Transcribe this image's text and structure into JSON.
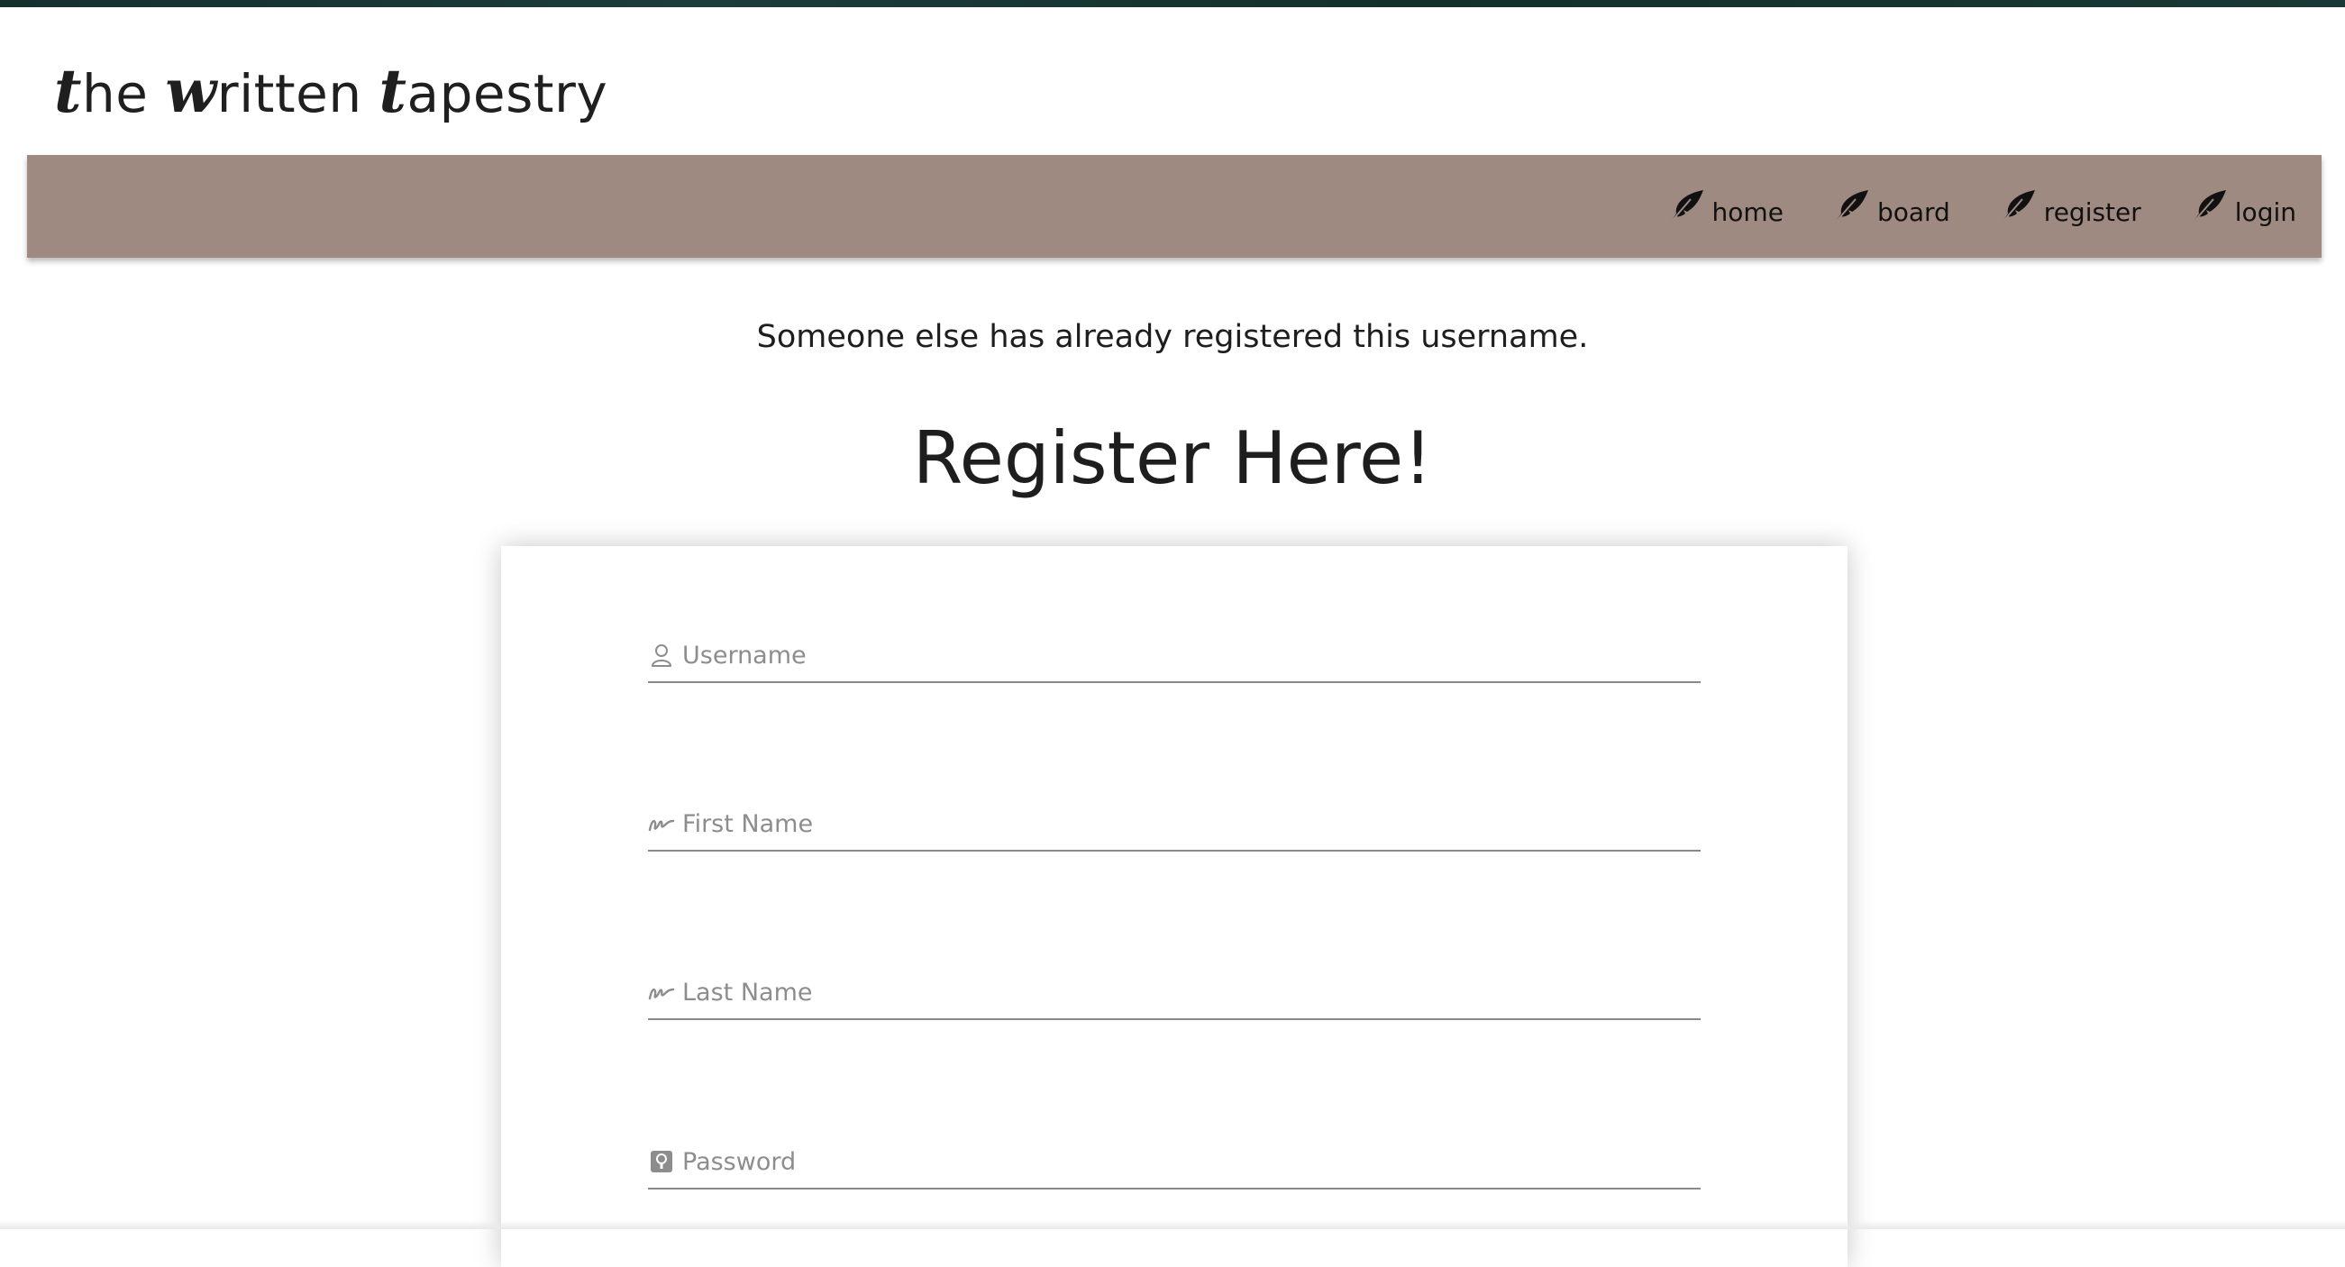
{
  "brand": {
    "cap1": "t",
    "rest1": "he ",
    "cap2": "w",
    "rest2": "ritten ",
    "cap3": "t",
    "rest3": "apestry"
  },
  "nav": {
    "items": [
      {
        "label": "home",
        "icon": "feather-icon"
      },
      {
        "label": "board",
        "icon": "feather-icon"
      },
      {
        "label": "register",
        "icon": "feather-icon"
      },
      {
        "label": "login",
        "icon": "feather-icon"
      }
    ],
    "background_color": "#9e8a80"
  },
  "message": "Someone else has already registered this username.",
  "title": "Register Here!",
  "form": {
    "username": {
      "placeholder": "Username",
      "value": "",
      "icon": "user-icon"
    },
    "first_name": {
      "placeholder": "First Name",
      "value": "",
      "icon": "signature-icon"
    },
    "last_name": {
      "placeholder": "Last Name",
      "value": "",
      "icon": "signature-icon"
    },
    "password": {
      "placeholder": "Password",
      "value": "",
      "icon": "key-icon"
    }
  }
}
